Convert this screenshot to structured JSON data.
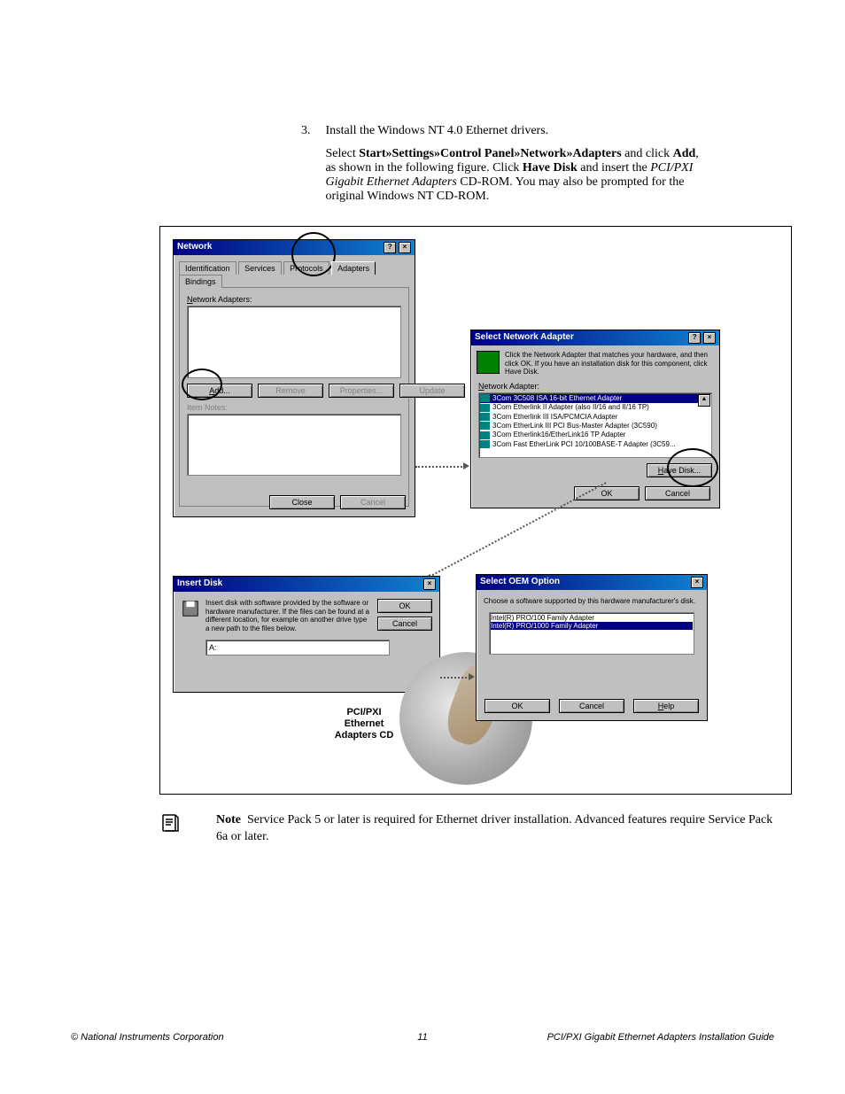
{
  "step": {
    "number": "3.",
    "title": "Install the Windows NT 4.0 Ethernet drivers.",
    "para_prefix": "Select ",
    "bold_path": "Start»Settings»Control Panel»Network»Adapters",
    "para_mid1": " and click ",
    "bold_add": "Add",
    "para_mid2": ", as shown in the following figure. Click ",
    "bold_have_disk": "Have Disk",
    "para_mid3": " and insert the ",
    "italic_cd": "PCI/PXI Gigabit Ethernet Adapters",
    "para_end": " CD-ROM. You may also be prompted for the original Windows NT CD-ROM."
  },
  "network_dialog": {
    "title": "Network",
    "tabs": [
      "Identification",
      "Services",
      "Protocols",
      "Adapters",
      "Bindings"
    ],
    "active_tab": 3,
    "list_label": "Network Adapters:",
    "buttons": {
      "add": "Add...",
      "remove": "Remove",
      "properties": "Properties...",
      "update": "Update"
    },
    "item_notes_label": "Item Notes:",
    "close": "Close",
    "cancel": "Cancel"
  },
  "select_adapter_dialog": {
    "title": "Select Network Adapter",
    "instruction": "Click the Network Adapter that matches your hardware, and then click OK.  If you have an installation disk for this component, click Have Disk.",
    "list_label": "Network Adapter:",
    "items": [
      "3Com 3C508 ISA 16-bit Ethernet Adapter",
      "3Com Etherlink II Adapter (also II/16 and II/16 TP)",
      "3Com Etherlink III ISA/PCMCIA Adapter",
      "3Com EtherLink III PCI Bus-Master Adapter (3C590)",
      "3Com Etherlink16/EtherLink16 TP Adapter",
      "3Com Fast EtherLink PCI 10/100BASE-T Adapter (3C59..."
    ],
    "have_disk": "Have Disk...",
    "ok": "OK",
    "cancel": "Cancel"
  },
  "insert_disk_dialog": {
    "title": "Insert Disk",
    "instruction": "Insert disk with software provided by the software or hardware manufacturer.  If the files can be found at a different location, for example on another drive type a new path to the files below.",
    "ok": "OK",
    "cancel": "Cancel",
    "path_value": "A:"
  },
  "select_oem_dialog": {
    "title": "Select OEM Option",
    "instruction": "Choose a software supported by this hardware manufacturer's disk.",
    "items": [
      "Intel(R) PRO/100 Family Adapter",
      "Intel(R) PRO/1000 Family Adapter"
    ],
    "ok": "OK",
    "cancel": "Cancel",
    "help": "Help"
  },
  "cd_label": {
    "line1": "PCI/PXI",
    "line2": "Ethernet",
    "line3": "Adapters CD"
  },
  "note": {
    "label": "Note",
    "text": "Service Pack 5 or later is required for Ethernet driver installation. Advanced features require Service Pack 6a or later."
  },
  "footer": {
    "left": "© National Instruments Corporation",
    "center": "11",
    "right": "PCI/PXI Gigabit Ethernet Adapters Installation Guide"
  }
}
